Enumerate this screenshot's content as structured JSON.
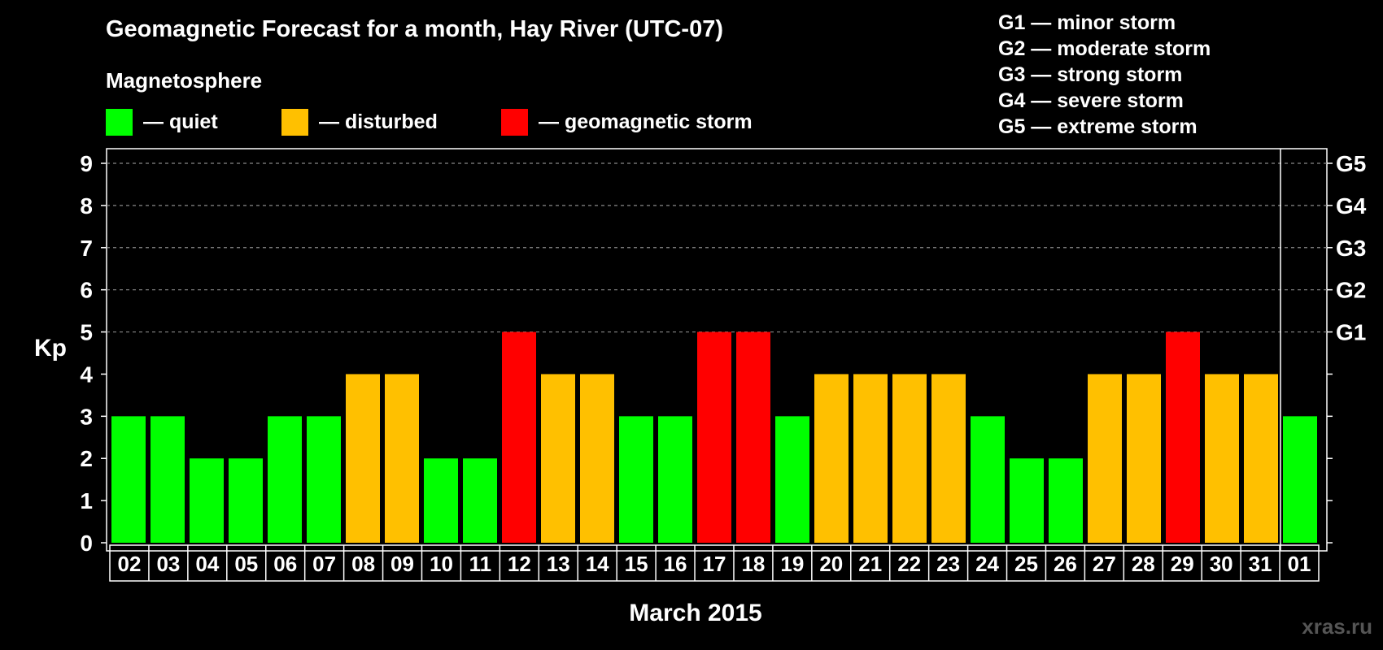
{
  "title": "Geomagnetic Forecast for a month, Hay River (UTC-07)",
  "subtitle": "Magnetosphere",
  "legend": [
    {
      "label": "— quiet",
      "color": "#00ff00"
    },
    {
      "label": "— disturbed",
      "color": "#ffc000"
    },
    {
      "label": "— geomagnetic storm",
      "color": "#ff0000"
    }
  ],
  "g_legend": [
    "G1 — minor storm",
    "G2 — moderate storm",
    "G3 — strong storm",
    "G4 — severe storm",
    "G5 — extreme storm"
  ],
  "watermark": "xras.ru",
  "chart_data": {
    "type": "bar",
    "ylabel": "Kp",
    "xlabel": "March 2015",
    "ylim": [
      0,
      9
    ],
    "yticks": [
      0,
      1,
      2,
      3,
      4,
      5,
      6,
      7,
      8,
      9
    ],
    "right_ticks": [
      {
        "value": 5,
        "label": "G1"
      },
      {
        "value": 6,
        "label": "G2"
      },
      {
        "value": 7,
        "label": "G3"
      },
      {
        "value": 8,
        "label": "G4"
      },
      {
        "value": 9,
        "label": "G5"
      }
    ],
    "dashed_gridlines": [
      5,
      6,
      7,
      8,
      9
    ],
    "categories": [
      "02",
      "03",
      "04",
      "05",
      "06",
      "07",
      "08",
      "09",
      "10",
      "11",
      "12",
      "13",
      "14",
      "15",
      "16",
      "17",
      "18",
      "19",
      "20",
      "21",
      "22",
      "23",
      "24",
      "25",
      "26",
      "27",
      "28",
      "29",
      "30",
      "31",
      "01"
    ],
    "values": [
      3,
      3,
      2,
      2,
      3,
      3,
      4,
      4,
      2,
      2,
      5,
      4,
      4,
      3,
      3,
      5,
      5,
      3,
      4,
      4,
      4,
      4,
      3,
      2,
      2,
      4,
      4,
      5,
      4,
      4,
      3
    ],
    "month_separator_before": "01",
    "color_rule": {
      "quiet": "#00ff00",
      "disturbed": "#ffc000",
      "storm": "#ff0000"
    },
    "color_thresholds": {
      "disturbed_at_least": 4,
      "storm_at_least": 5
    }
  }
}
